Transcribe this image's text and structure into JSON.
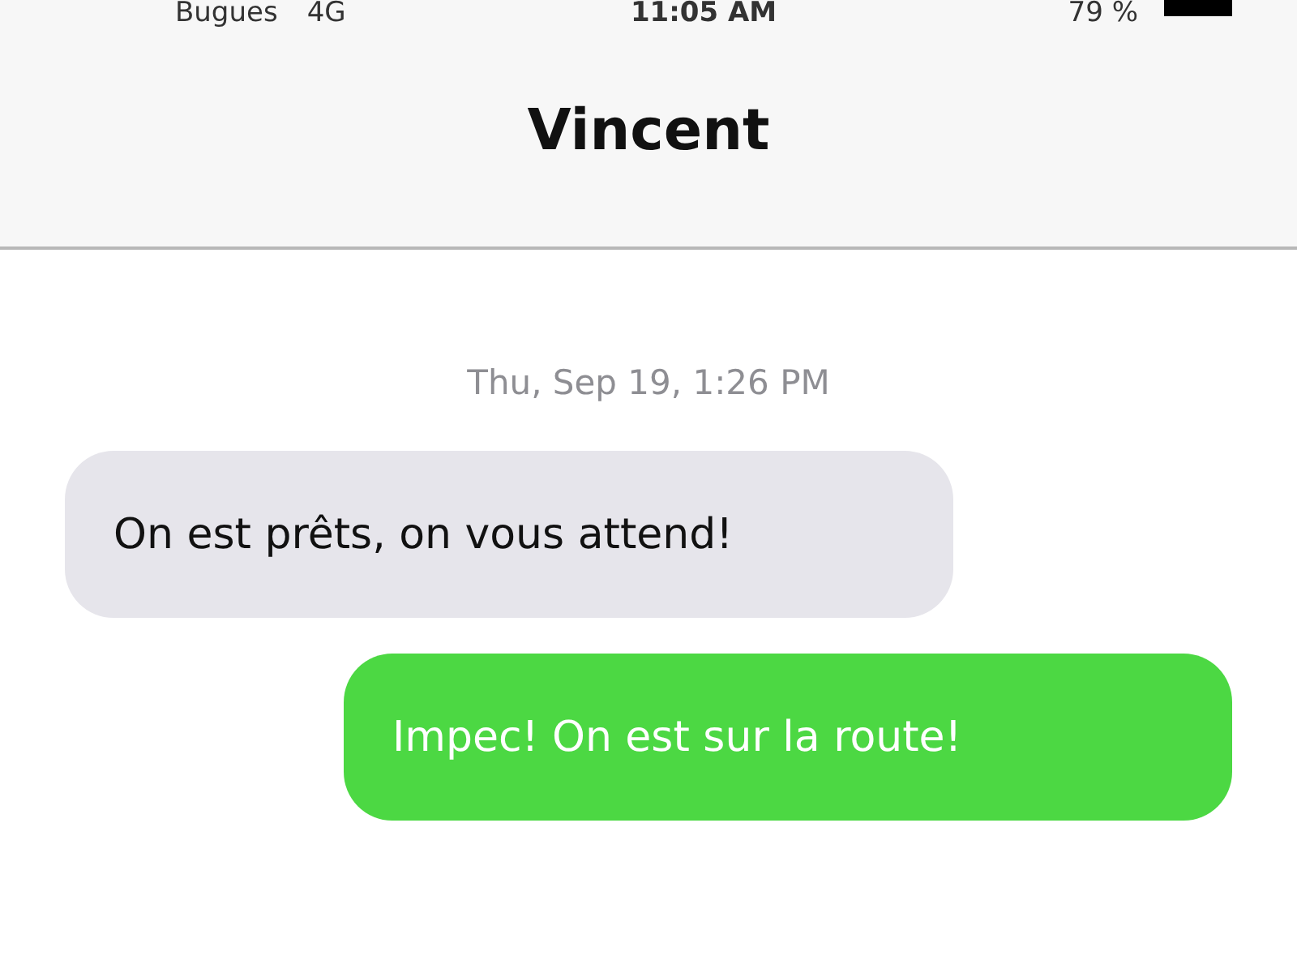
{
  "status_bar": {
    "carrier": "Bugues",
    "network": "4G",
    "time": "11:05 AM",
    "battery": "79 %"
  },
  "header": {
    "title": "Vincent"
  },
  "timestamp": "Thu, Sep 19, 1:26 PM",
  "messages": [
    {
      "text": "On est prêts, on vous attend!",
      "kind": "received"
    },
    {
      "text": "Impec! On est sur la route!",
      "kind": "sent"
    }
  ]
}
